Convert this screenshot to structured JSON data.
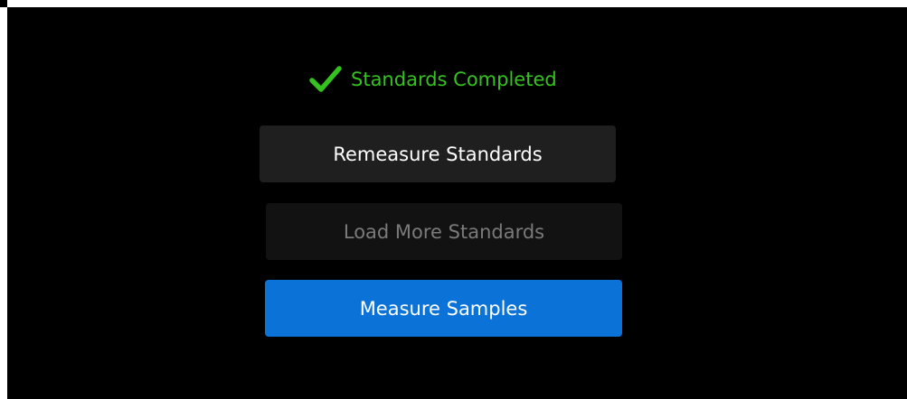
{
  "status": {
    "icon": "checkmark-icon",
    "text": "Standards Completed",
    "color": "#35c11f"
  },
  "buttons": {
    "remeasure_label": "Remeasure Standards",
    "load_more_label": "Load More Standards",
    "load_more_disabled": true,
    "measure_label": "Measure Samples",
    "accent_color": "#0b73d8"
  }
}
